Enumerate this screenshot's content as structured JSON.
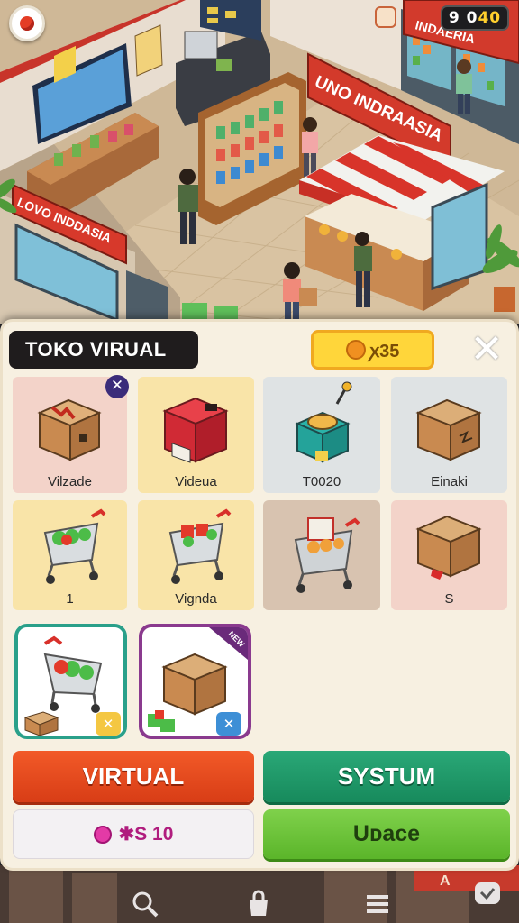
{
  "hud": {
    "counter_main": "9 0",
    "counter_accent": "40"
  },
  "scene": {
    "sign_top": "INDAERIA",
    "sign_stall": "UNO INDRAASIA",
    "sign_left": "LOVO INDDASIA",
    "sign_bottom": "A"
  },
  "panel": {
    "title": "TOKO VIRUAL",
    "coin_value": "ꭗ35",
    "close_label": "✕"
  },
  "items": [
    {
      "label": "Vilzade",
      "icon": "box-icon"
    },
    {
      "label": "Videua",
      "icon": "red-crate-icon"
    },
    {
      "label": "T0020",
      "icon": "juicer-machine-icon"
    },
    {
      "label": "Einaki",
      "icon": "box-icon"
    },
    {
      "label": "1",
      "icon": "shopping-cart-icon"
    },
    {
      "label": "Vignda",
      "icon": "shopping-cart-icon"
    },
    {
      "label": "",
      "icon": "shopping-cart-icon"
    },
    {
      "label": "S",
      "icon": "box-icon"
    }
  ],
  "featured": [
    {
      "icon": "shopping-cart-icon",
      "badge": "✕"
    },
    {
      "icon": "box-icon",
      "badge": "✕",
      "ribbon": "NEW"
    }
  ],
  "buttons": {
    "virtual": "VIRTUAL",
    "systum": "SYSTUM",
    "price": "✱S 10",
    "update": "Uᴅace"
  },
  "colors": {
    "primary": "#e24a1f",
    "secondary": "#1f9a6a",
    "update": "#6cc43a",
    "coin": "#ffd63a"
  }
}
